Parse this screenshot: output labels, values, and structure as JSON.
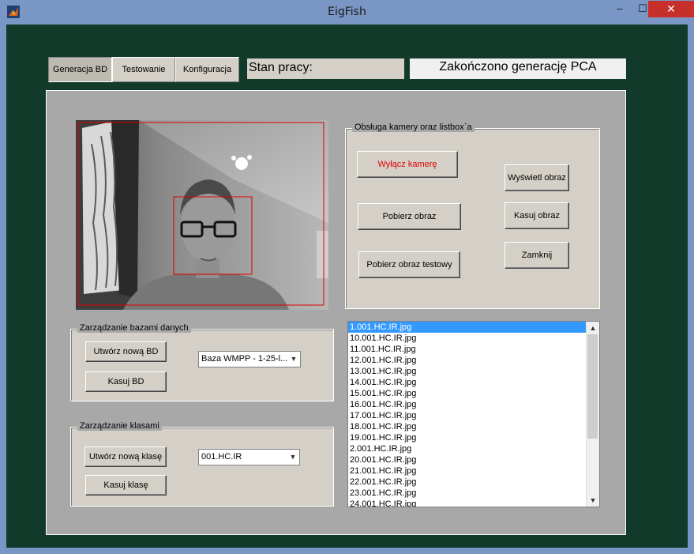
{
  "window": {
    "title": "EigFish",
    "min_glyph": "–",
    "max_glyph": "☐",
    "close_glyph": "✕"
  },
  "tabs": [
    {
      "label": "Generacja BD"
    },
    {
      "label": "Testowanie"
    },
    {
      "label": "Konfiguracja"
    }
  ],
  "status": {
    "label": "Stan pracy:",
    "value": "Zakończono generację PCA"
  },
  "camera_group": {
    "title": "Obsługa kamery oraz listbox`a",
    "buttons": {
      "toggle_camera": "Wyłącz kamerę",
      "capture": "Pobierz obraz",
      "capture_test": "Pobierz obraz testowy",
      "show": "Wyświetl obraz",
      "delete": "Kasuj obraz",
      "close": "Zamknij"
    },
    "toggle_color": "#e00000"
  },
  "db_group": {
    "title": "Zarządzanie bazami danych",
    "create": "Utwórz nową BD",
    "delete": "Kasuj BD",
    "selected_db": "Baza WMPP - 1-25-l..."
  },
  "class_group": {
    "title": "Zarządzanie klasami",
    "create": "Utwórz nową klasę",
    "delete": "Kasuj klasę",
    "selected_class": "001.HC.IR"
  },
  "file_list": [
    "1.001.HC.IR.jpg",
    "10.001.HC.IR.jpg",
    "11.001.HC.IR.jpg",
    "12.001.HC.IR.jpg",
    "13.001.HC.IR.jpg",
    "14.001.HC.IR.jpg",
    "15.001.HC.IR.jpg",
    "16.001.HC.IR.jpg",
    "17.001.HC.IR.jpg",
    "18.001.HC.IR.jpg",
    "19.001.HC.IR.jpg",
    "2.001.HC.IR.jpg",
    "20.001.HC.IR.jpg",
    "21.001.HC.IR.jpg",
    "22.001.HC.IR.jpg",
    "23.001.HC.IR.jpg",
    "24.001.HC.IR.jpg"
  ],
  "selected_index": 0,
  "colors": {
    "background": "#123a2a",
    "panel": "#a8a8a8",
    "selection": "#3399ff",
    "detection_box": "#e00000"
  }
}
